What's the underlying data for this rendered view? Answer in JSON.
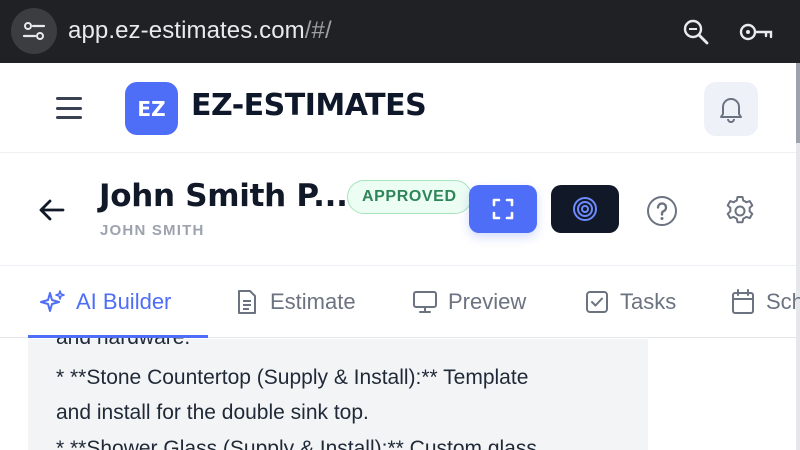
{
  "browser": {
    "url_host": "app.ez-estimates.com",
    "url_path": "/#/",
    "icons": [
      "site-info-icon",
      "zoom-icon",
      "key-icon"
    ]
  },
  "header": {
    "logo_badge": "EZ",
    "logo_text": "EZ-ESTIMATES",
    "icons": [
      "hamburger-icon",
      "bell-icon"
    ]
  },
  "project": {
    "title": "John Smith P...",
    "client": "JOHN SMITH",
    "status": "APPROVED",
    "colors": {
      "accent": "#4f6ef7",
      "dark": "#111827",
      "approved": "#2f855a"
    },
    "icons": [
      "back-arrow-icon",
      "expand-icon",
      "target-icon",
      "help-icon",
      "gear-icon"
    ]
  },
  "tabs": [
    {
      "label": "AI Builder",
      "icon": "sparkle-icon",
      "active": true
    },
    {
      "label": "Estimate",
      "icon": "document-icon",
      "active": false
    },
    {
      "label": "Preview",
      "icon": "monitor-icon",
      "active": false
    },
    {
      "label": "Tasks",
      "icon": "checkbox-icon",
      "active": false
    },
    {
      "label": "Sch",
      "icon": "calendar-icon",
      "active": false
    }
  ],
  "content": {
    "lines": [
      "and hardware.",
      "*   **Stone Countertop (Supply & Install):** Template",
      "and install for the double sink top.",
      "*   **Shower Glass (Supply & Install):** Custom glass"
    ]
  }
}
